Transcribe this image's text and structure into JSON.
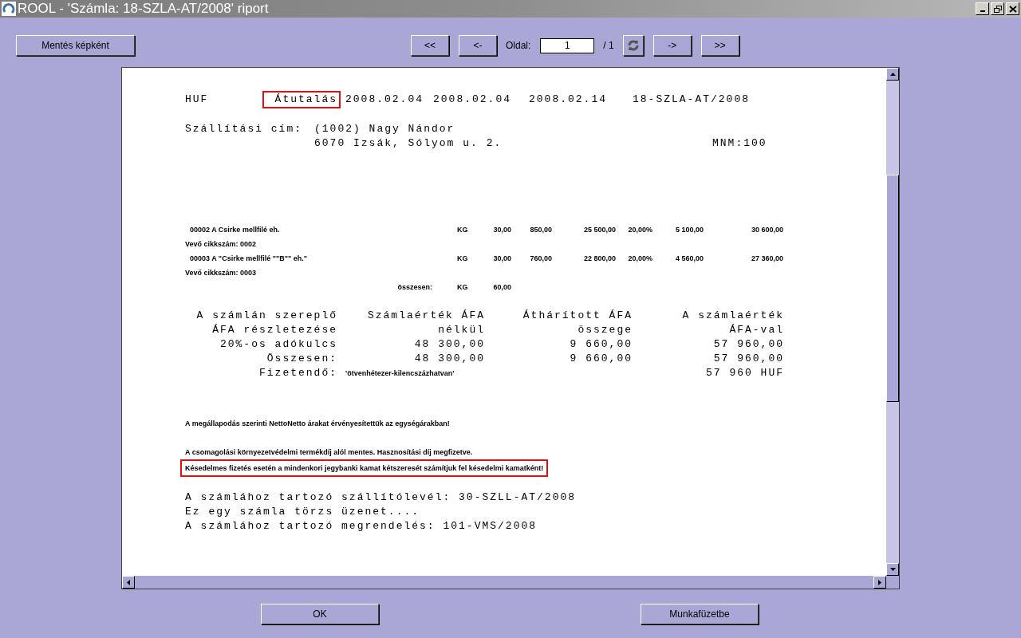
{
  "window": {
    "title": "ROOL  -  'Számla: 18-SZLA-AT/2008' riport"
  },
  "toolbar": {
    "save_button": "Mentés képként",
    "first_button": "<<",
    "prev_button": "<-",
    "page_label": "Oldal:",
    "page_value": "1",
    "page_total": "/ 1",
    "next_button": "->",
    "last_button": ">>"
  },
  "report": {
    "header": {
      "currency": "HUF",
      "payment_method": "Átutalás",
      "payment_highlighted": true,
      "date_1": "2008.02.04",
      "date_2": "2008.02.04",
      "date_3": "2008.02.14",
      "invoice_number": "18-SZLA-AT/2008"
    },
    "shipping": {
      "label": "Szállítási cím:",
      "name": "(1002) Nagy Nándor",
      "address": "6070 Izsák, Sólyom u. 2.",
      "code": "MNM:100"
    },
    "items": [
      {
        "kind": "item",
        "description": "00002 A Csirke mellfilé eh.",
        "unit": "KG",
        "quantity": "30,00",
        "price": "850,00",
        "net": "25 500,00",
        "rate": "20,00%",
        "vat": "5 100,00",
        "gross": "30 600,00"
      },
      {
        "kind": "note",
        "description": "Vevő cikkszám: 0002"
      },
      {
        "kind": "item",
        "description": "00003 A \"Csirke mellfilé \"\"B\"\" eh.\"",
        "unit": "KG",
        "quantity": "30,00",
        "price": "760,00",
        "net": "22 800,00",
        "rate": "20,00%",
        "vat": "4 560,00",
        "gross": "27 360,00"
      },
      {
        "kind": "note",
        "description": "Vevő cikkszám: 0003"
      },
      {
        "kind": "total",
        "description": "összesen:",
        "unit": "KG",
        "quantity": "60,00"
      }
    ],
    "vat_table": {
      "rows": [
        [
          "A számlán szereplő",
          "Számlaérték ÁFA",
          "Áthárított ÁFA",
          "A számlaérték"
        ],
        [
          "ÁFA részletezése",
          "nélkül",
          "összege",
          "ÁFA-val"
        ],
        [
          "20%-os adókulcs",
          "48 300,00",
          "9 660,00",
          "57 960,00"
        ],
        [
          "Összesen:",
          "48 300,00",
          "9 660,00",
          "57 960,00"
        ]
      ],
      "payable": {
        "label": "Fizetendő:",
        "words": "'ötvenhétezer-kilencszázhatvan'",
        "amount": "57 960 HUF"
      }
    },
    "note_groups": [
      [
        {
          "text": "A megállapodás szerinti NettoNetto árakat érvényesítettük az egységárakban!",
          "highlighted": false
        }
      ],
      [
        {
          "text": "A csomagolási környezetvédelmi termékdíj alól mentes. Hasznosítási díj megfizetve.",
          "highlighted": false
        },
        {
          "text": "Késedelmes fizetés esetén a mindenkori jegybanki kamat kétszeresét számítjuk fel késedelmi kamatként!",
          "highlighted": true
        }
      ]
    ],
    "footer_lines": [
      "A számlához tartozó szállítólevél: 30-SZLL-AT/2008",
      "Ez egy számla törzs üzenet....",
      "A számlához tartozó megrendelés: 101-VMS/2008"
    ]
  },
  "buttons": [
    {
      "label": "OK"
    },
    {
      "label": "Munkafüzetbe"
    }
  ]
}
